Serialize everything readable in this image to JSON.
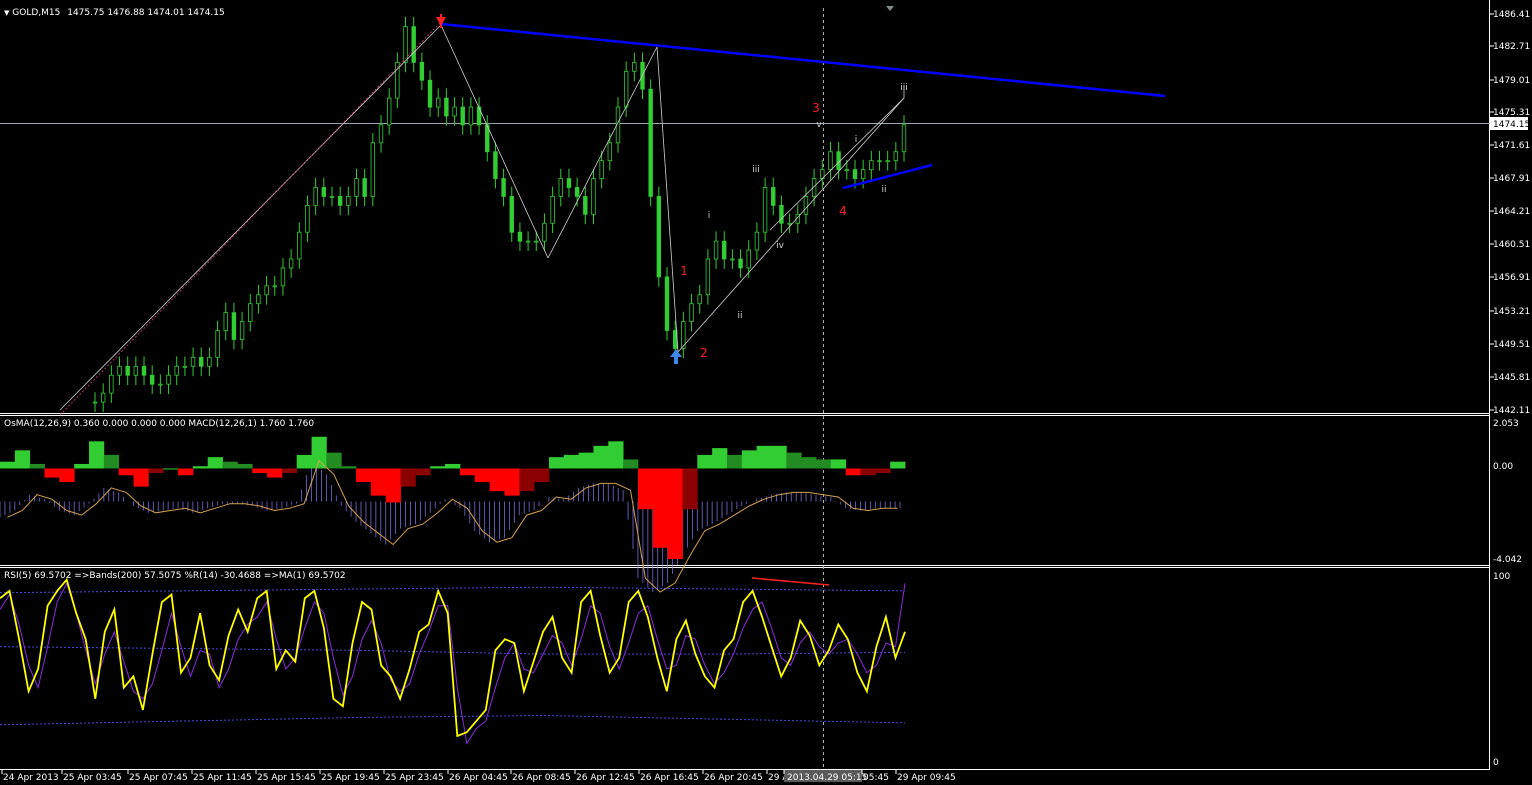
{
  "header": {
    "arrow_glyph": "▼",
    "symbol": "GOLD,M15",
    "ohlc": "1475.75 1476.88 1474.01 1474.15"
  },
  "main_pane": {
    "price_ticks": [
      "1486.41",
      "1482.71",
      "1479.01",
      "1475.31",
      "1471.61",
      "1467.91",
      "1464.21",
      "1460.51",
      "1456.91",
      "1453.21",
      "1449.51",
      "1445.81",
      "1442.11"
    ],
    "current_price": "1474.15",
    "wave_labels_major": [
      "1",
      "2",
      "3",
      "4"
    ],
    "wave_labels_minor": [
      "i",
      "ii",
      "iii",
      "iv",
      "v",
      "i",
      "ii",
      "iii"
    ]
  },
  "osma_pane": {
    "label": "OsMA(12,26,9) 0.360 0.000 0.000 0.000  MACD(12,26,1) 1.760 1.760",
    "ticks": [
      "2.053",
      "0.00",
      "-4.042"
    ]
  },
  "rsi_pane": {
    "label": "RSI(5) 69.5702  =>Bands(200) 57.5075  %R(14) -30.4688  =>MA(1) 69.5702",
    "ticks": [
      "100",
      "0"
    ]
  },
  "time_axis": {
    "labels": [
      "24 Apr 2013",
      "25 Apr 03:45",
      "25 Apr 07:45",
      "25 Apr 11:45",
      "25 Apr 15:45",
      "25 Apr 19:45",
      "25 Apr 23:45",
      "26 Apr 04:45",
      "26 Apr 08:45",
      "26 Apr 12:45",
      "26 Apr 16:45",
      "26 Apr 20:45",
      "29 A",
      "2013.04.29 05:15",
      "05:45",
      "29 Apr 09:45"
    ]
  },
  "colors": {
    "bull_candle": "#32cd32",
    "trendline": "#0000ff",
    "wave_major": "#ff0000",
    "rsi_line": "#ffff00",
    "wpr_line": "#8a2be2",
    "bands": "#6060ff"
  },
  "chart_data": [
    {
      "type": "line",
      "title": "GOLD,M15",
      "series": [
        {
          "name": "GOLD,M15",
          "values": [
            1443,
            1444,
            1446,
            1447,
            1446,
            1447,
            1446,
            1445,
            1445,
            1446,
            1447,
            1447,
            1448,
            1447,
            1448,
            1451,
            1453,
            1450,
            1452,
            1454,
            1455,
            1456,
            1456,
            1458,
            1459,
            1462,
            1465,
            1467,
            1466,
            1466,
            1465,
            1466,
            1468,
            1466,
            1472,
            1474,
            1477,
            1481,
            1485,
            1481,
            1479,
            1476,
            1477,
            1475,
            1476,
            1474,
            1476,
            1474,
            1471,
            1468,
            1466,
            1462,
            1461,
            1461,
            1461,
            1463,
            1466,
            1468,
            1467,
            1466,
            1464,
            1468,
            1470,
            1472,
            1476,
            1480,
            1481,
            1478,
            1466,
            1457,
            1451,
            1449,
            1452,
            1454,
            1455,
            1459,
            1461,
            1459,
            1459,
            1458,
            1460,
            1462,
            1467,
            1465,
            1463,
            1463,
            1464,
            1466,
            1468,
            1469,
            1471,
            1469,
            1469,
            1468,
            1469,
            1470,
            1470,
            1470,
            1471,
            1474
          ]
        }
      ],
      "ylim": [
        1442.11,
        1486.41
      ]
    },
    {
      "type": "bar",
      "title": "OsMA(12,26,9)",
      "series": [
        {
          "name": "OsMA",
          "values": [
            0.3,
            0.8,
            0.2,
            -0.4,
            -0.6,
            0.2,
            1.2,
            0.6,
            -0.3,
            -0.8,
            -0.2,
            0.0,
            -0.3,
            0.1,
            0.5,
            0.3,
            0.2,
            -0.2,
            -0.4,
            -0.2,
            0.6,
            1.4,
            0.7,
            0.1,
            -0.6,
            -1.2,
            -1.5,
            -0.8,
            -0.3,
            0.1,
            0.2,
            -0.3,
            -0.6,
            -1.0,
            -1.2,
            -1.0,
            -0.6,
            0.5,
            0.6,
            0.7,
            1.0,
            1.2,
            0.4,
            -1.8,
            -3.5,
            -4.0,
            -1.8,
            0.6,
            0.9,
            0.6,
            0.8,
            1.0,
            1.0,
            0.7,
            0.5,
            0.4,
            0.4,
            -0.3,
            -0.3,
            -0.2,
            0.3
          ]
        },
        {
          "name": "MACD",
          "values": [
            -0.7,
            -0.4,
            0.3,
            0.1,
            -0.4,
            -0.6,
            -0.1,
            0.6,
            0.4,
            -0.2,
            -0.5,
            -0.4,
            -0.3,
            -0.5,
            -0.3,
            -0.1,
            -0.1,
            -0.2,
            -0.4,
            -0.3,
            -0.1,
            1.8,
            1.2,
            -0.2,
            -0.9,
            -1.4,
            -1.9,
            -1.2,
            -1.0,
            -0.5,
            0.1,
            -0.3,
            -1.3,
            -1.8,
            -1.6,
            -0.6,
            -0.4,
            0.2,
            0.1,
            0.6,
            0.8,
            0.8,
            0.5,
            -3.4,
            -4.0,
            -3.6,
            -2.4,
            -1.3,
            -1.0,
            -0.6,
            -0.2,
            0.1,
            0.3,
            0.4,
            0.4,
            0.3,
            0.2,
            -0.3,
            -0.4,
            -0.3,
            -0.3
          ]
        }
      ],
      "ylim": [
        -4.042,
        2.053
      ]
    },
    {
      "type": "line",
      "title": "RSI(5)",
      "series": [
        {
          "name": "RSI(5)",
          "values": [
            88,
            92,
            66,
            38,
            50,
            84,
            92,
            98,
            80,
            66,
            34,
            70,
            82,
            40,
            46,
            28,
            58,
            86,
            90,
            48,
            56,
            80,
            52,
            44,
            68,
            82,
            70,
            88,
            92,
            50,
            60,
            54,
            88,
            92,
            72,
            34,
            30,
            64,
            86,
            82,
            52,
            46,
            34,
            50,
            70,
            74,
            92,
            80,
            14,
            16,
            22,
            28,
            60,
            66,
            64,
            38,
            54,
            70,
            78,
            56,
            48,
            86,
            92,
            68,
            48,
            56,
            86,
            92,
            78,
            56,
            38,
            66,
            76,
            58,
            46,
            40,
            60,
            66,
            86,
            92,
            78,
            62,
            46,
            56,
            76,
            68,
            52,
            60,
            74,
            66,
            48,
            38,
            62,
            78,
            56,
            70
          ]
        },
        {
          "name": "%R(14)",
          "values": [
            82,
            90,
            74,
            52,
            40,
            62,
            86,
            96,
            80,
            60,
            42,
            58,
            70,
            54,
            38,
            34,
            42,
            60,
            80,
            62,
            46,
            60,
            58,
            40,
            50,
            66,
            74,
            78,
            86,
            66,
            50,
            56,
            72,
            86,
            80,
            56,
            36,
            46,
            66,
            76,
            64,
            44,
            38,
            42,
            58,
            70,
            84,
            84,
            40,
            10,
            18,
            22,
            40,
            56,
            64,
            50,
            48,
            58,
            68,
            64,
            52,
            66,
            84,
            80,
            62,
            50,
            64,
            80,
            84,
            66,
            50,
            52,
            68,
            66,
            52,
            42,
            48,
            58,
            72,
            82,
            86,
            72,
            56,
            52,
            64,
            70,
            62,
            58,
            64,
            66,
            58,
            48,
            52,
            64,
            62,
            96
          ]
        }
      ],
      "ylim": [
        0,
        100
      ]
    }
  ]
}
